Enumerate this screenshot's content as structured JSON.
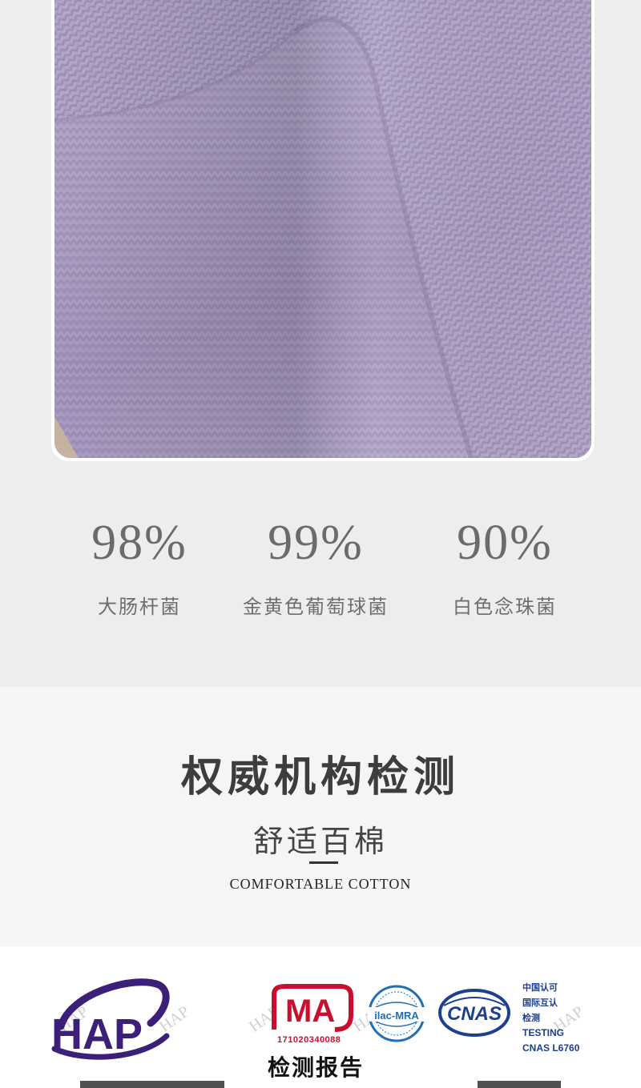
{
  "stats": [
    {
      "value": "98%",
      "label": "大肠杆菌"
    },
    {
      "value": "99%",
      "label": "金黄色葡萄球菌"
    },
    {
      "value": "90%",
      "label": "白色念珠菌"
    }
  ],
  "heading": {
    "title": "权威机构检测",
    "subtitle": "舒适百棉",
    "english": "COMFORTABLE COTTON"
  },
  "report": {
    "hap_logo": "HAP",
    "watermark": "HAP",
    "cma_logo": "MA",
    "cma_number": "171020340088",
    "ilac_logo": "ilac-MRA",
    "cnas_logo": "CNAS",
    "cnas_lines": [
      "中国认可",
      "国际互认",
      "检测",
      "TESTING",
      "CNAS L6760"
    ],
    "title": "检测报告"
  },
  "colors": {
    "fabric": "#a89bbf",
    "hap_purple": "#3b1f78",
    "cma_red": "#c8102e",
    "cnas_blue": "#1c3f8f"
  }
}
